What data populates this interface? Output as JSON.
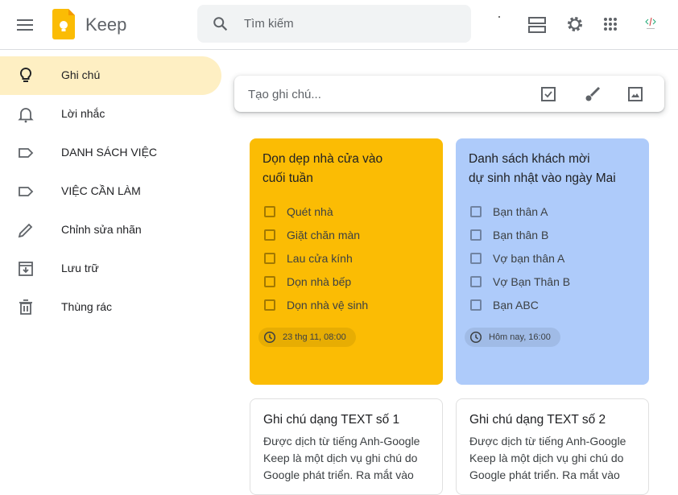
{
  "header": {
    "app_name": "Keep",
    "search_placeholder": "Tìm kiếm"
  },
  "sidebar": {
    "items": [
      {
        "label": "Ghi chú",
        "icon": "lightbulb-icon",
        "active": true
      },
      {
        "label": "Lời nhắc",
        "icon": "bell-icon"
      },
      {
        "label": "DANH SÁCH VIỆC",
        "icon": "label-icon"
      },
      {
        "label": "VIỆC CẦN LÀM",
        "icon": "label-icon"
      },
      {
        "label": "Chỉnh sửa nhãn",
        "icon": "pencil-icon"
      },
      {
        "label": "Lưu trữ",
        "icon": "archive-icon"
      },
      {
        "label": "Thùng rác",
        "icon": "trash-icon"
      }
    ]
  },
  "create": {
    "placeholder": "Tạo ghi chú..."
  },
  "notes": [
    {
      "title_line1": "Dọn dẹp nhà cửa vào",
      "title_line2": "cuối tuần",
      "color": "#fbbc04",
      "items": [
        "Quét nhà",
        "Giặt chăn màn",
        "Lau cửa kính",
        "Dọn nhà bếp",
        "Dọn nhà vệ sinh"
      ],
      "reminder": "23 thg 11, 08:00"
    },
    {
      "title_line1": "Danh sách khách mời",
      "title_line2": "dự sinh nhật vào ngày Mai",
      "color": "#aecbfa",
      "items": [
        "Bạn thân A",
        "Bạn thân B",
        "Vợ bạn thân A",
        "Vợ Bạn Thân B",
        "Bạn ABC"
      ],
      "reminder": "Hôm nay, 16:00"
    },
    {
      "title": "Ghi chú dạng TEXT số 1",
      "lines": [
        "Được dịch từ tiếng Anh-Google",
        "Keep là một dịch vụ ghi chú do",
        "Google phát triển. Ra mắt vào"
      ]
    },
    {
      "title": "Ghi chú dạng TEXT số 2",
      "lines": [
        "Được dịch từ tiếng Anh-Google",
        "Keep là một dịch vụ ghi chú do",
        "Google phát triển. Ra mắt vào"
      ]
    }
  ]
}
